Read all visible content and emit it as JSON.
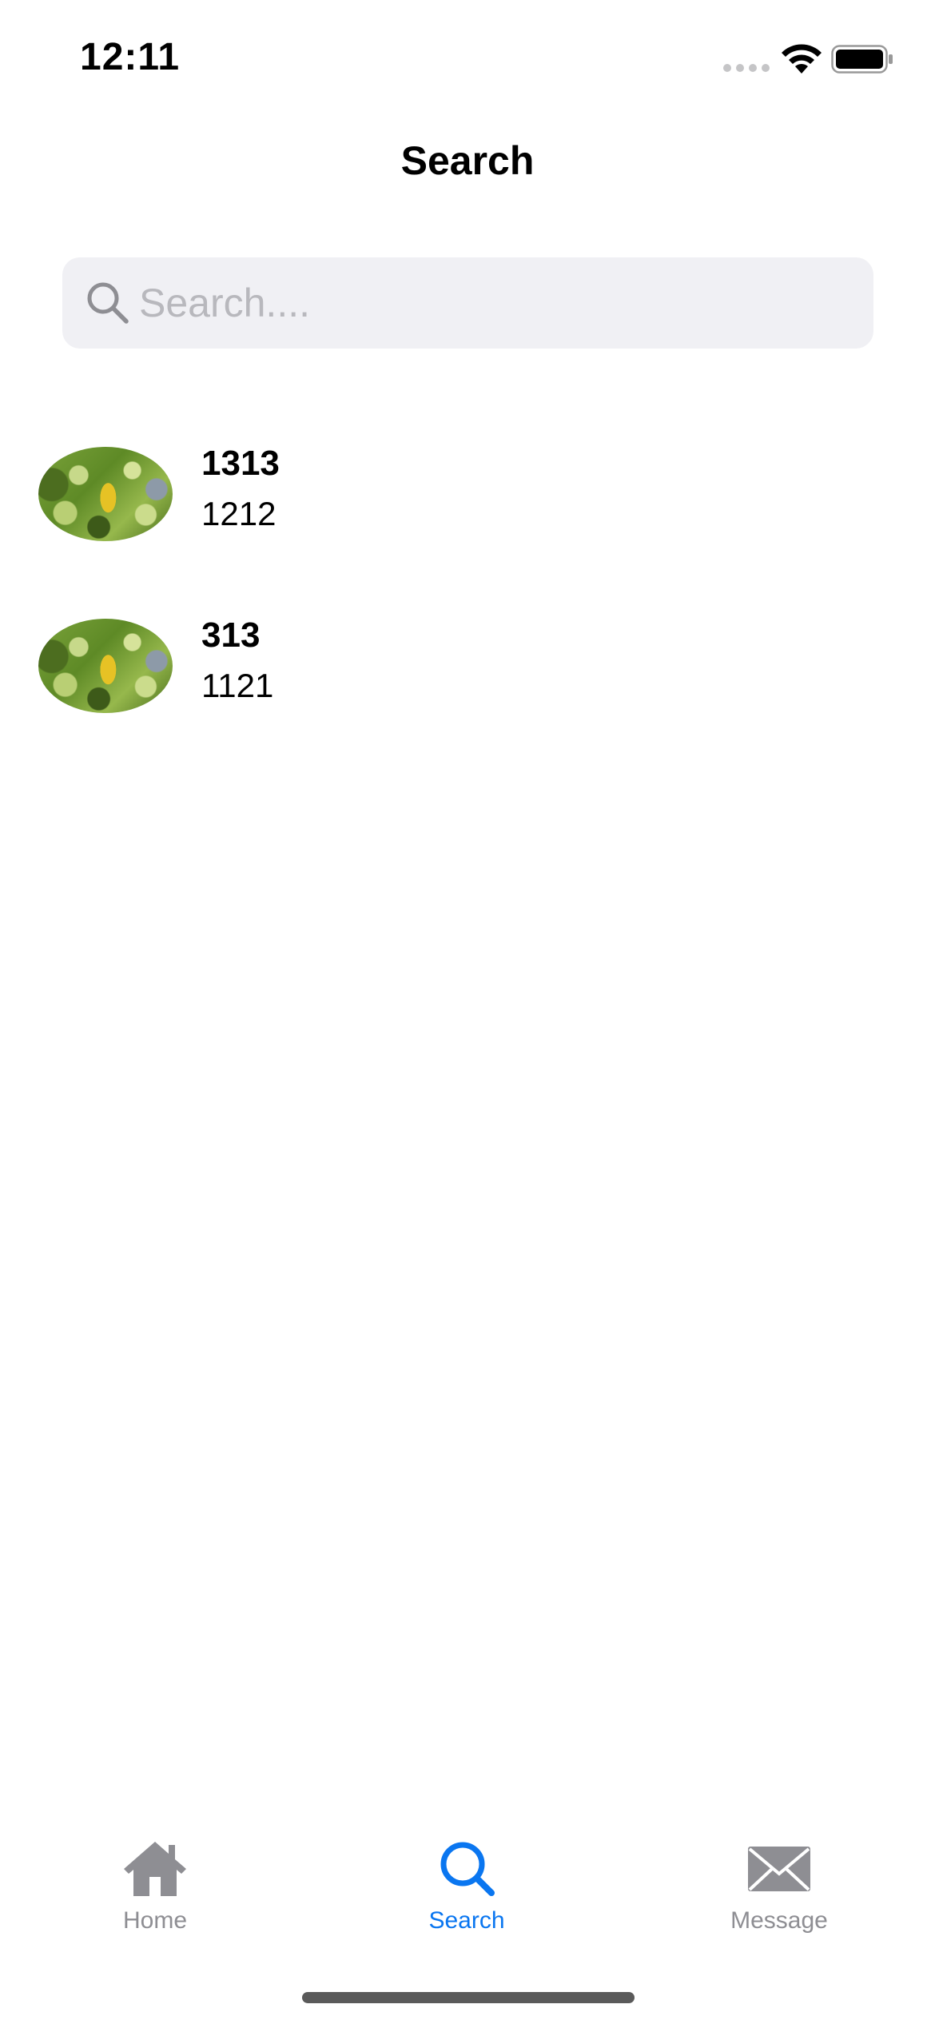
{
  "status_bar": {
    "time": "12:11"
  },
  "nav": {
    "title": "Search"
  },
  "search": {
    "placeholder": "Search....",
    "value": ""
  },
  "results": [
    {
      "title": "1313",
      "subtitle": "1212"
    },
    {
      "title": "313",
      "subtitle": "1121"
    }
  ],
  "tab_bar": {
    "tabs": [
      {
        "label": "Home",
        "icon": "house-icon",
        "selected": false
      },
      {
        "label": "Search",
        "icon": "magnifying-glass-icon",
        "selected": true
      },
      {
        "label": "Message",
        "icon": "envelope-icon",
        "selected": false
      }
    ]
  },
  "colors": {
    "accent": "#0a76f0",
    "inactive": "#8e8e93",
    "search_field_bg": "#f0f0f4"
  }
}
